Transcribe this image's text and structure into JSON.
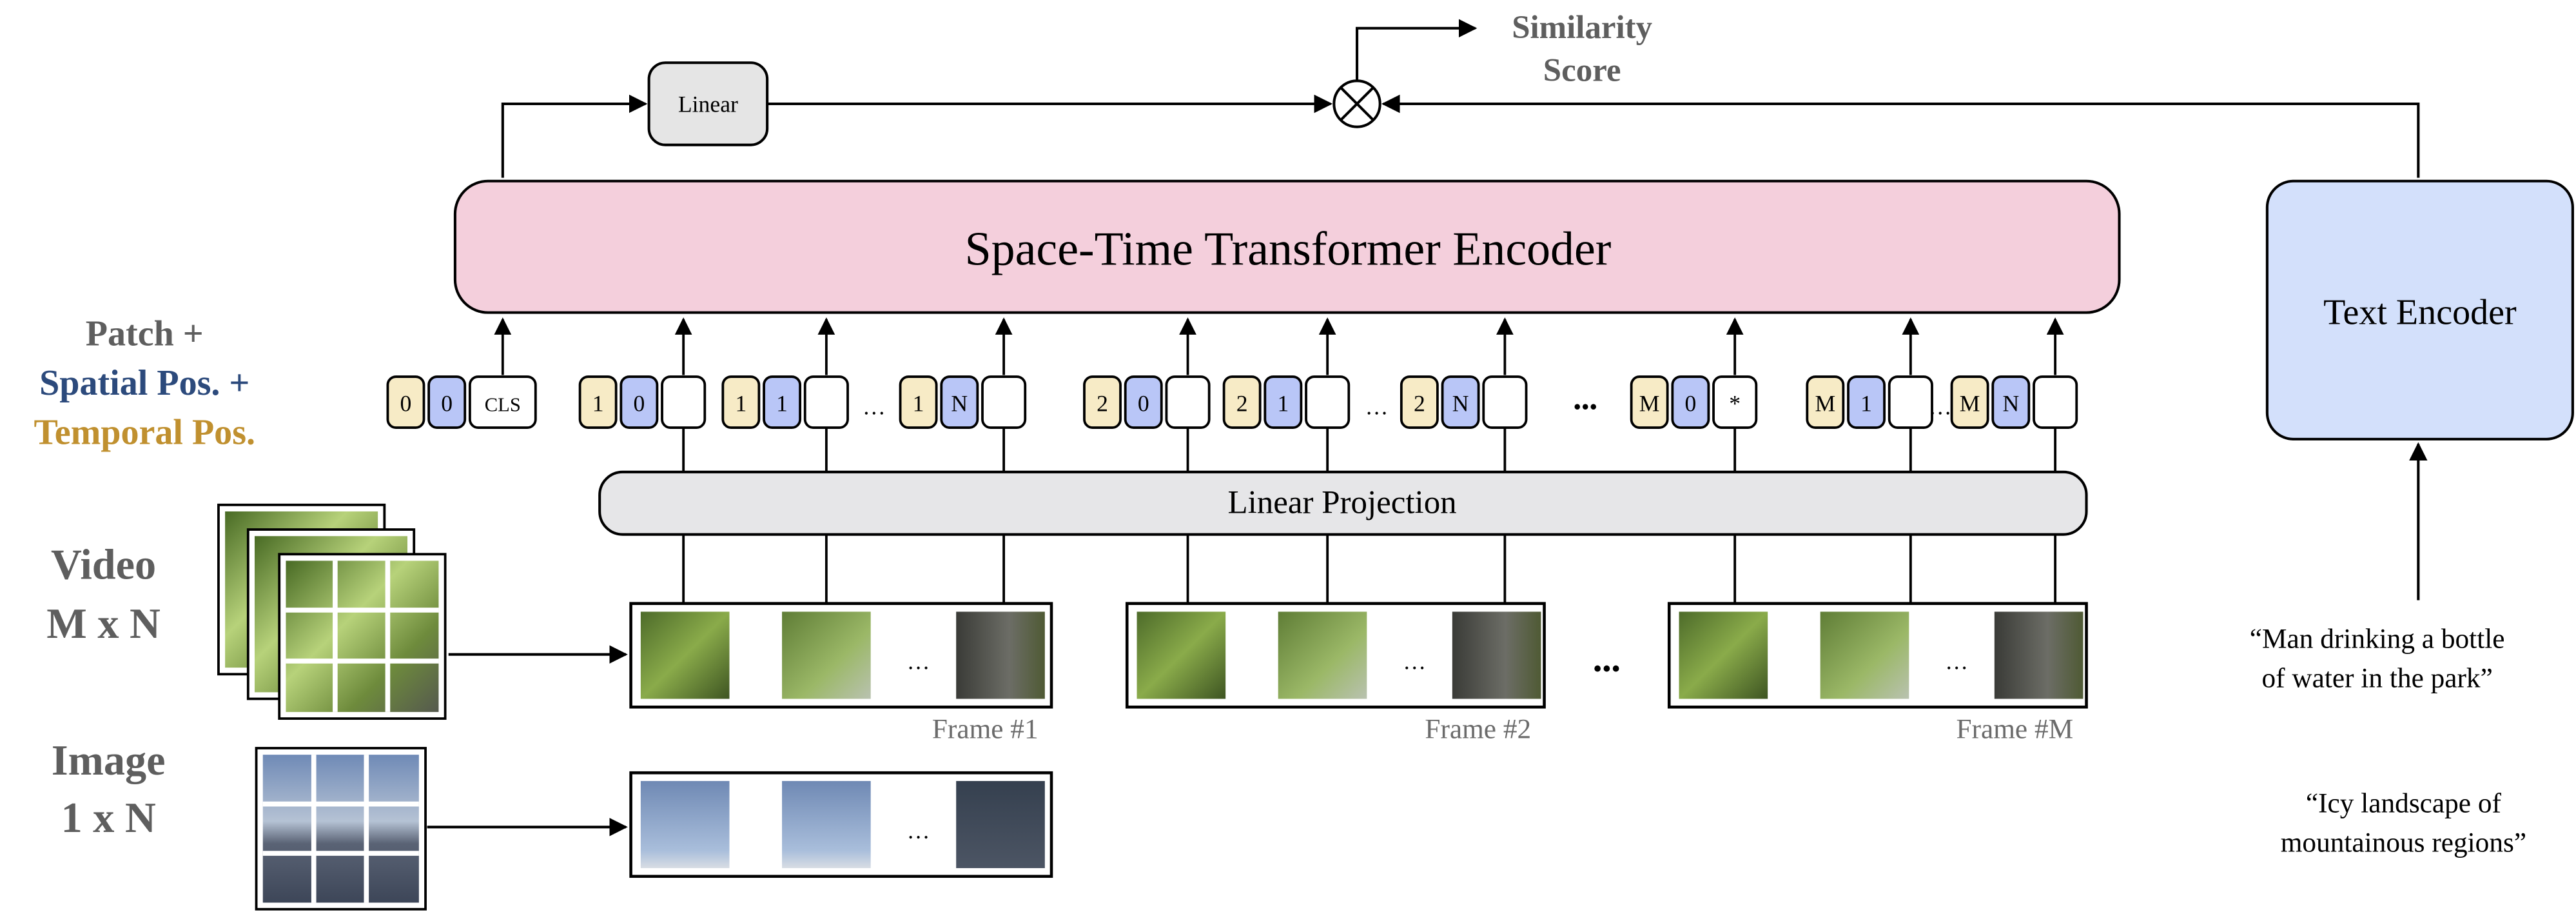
{
  "linear_label": "Linear",
  "similarity": {
    "line1": "Similarity",
    "line2": "Score"
  },
  "encoder_label": "Space-Time Transformer Encoder",
  "text_encoder_label": "Text Encoder",
  "projection_label": "Linear Projection",
  "legend": {
    "patch": "Patch +",
    "spatial": "Spatial Pos. +",
    "temporal": "Temporal Pos.",
    "spatial_color": "#2c4a7c",
    "temporal_color": "#c0902f"
  },
  "inputs": {
    "video_line1": "Video",
    "video_line2": "M x N",
    "image_line1": "Image",
    "image_line2": "1 x N"
  },
  "frames": [
    "Frame #1",
    "Frame #2",
    "Frame #M"
  ],
  "ellipsis": "…",
  "big_ellipsis": "•••",
  "captions": {
    "video_line1": "“Man drinking a bottle",
    "video_line2": "of water in the park”",
    "image_line1": "“Icy landscape of",
    "image_line2": "mountainous regions”"
  },
  "colors": {
    "temporal_token": "#f7ebc6",
    "spatial_token": "#b9c6f7",
    "encoder_fill": "#f4cfdc",
    "text_encoder_fill": "#d3e0fb",
    "projection_fill": "#e6e6e8",
    "label_gray": "#5e5e5e"
  },
  "tokens": [
    {
      "temporal": "0",
      "spatial": "0",
      "patch": "CLS"
    },
    {
      "temporal": "1",
      "spatial": "0",
      "patch": ""
    },
    {
      "temporal": "1",
      "spatial": "1",
      "patch": ""
    },
    {
      "temporal": "1",
      "spatial": "N",
      "patch": ""
    },
    {
      "temporal": "2",
      "spatial": "0",
      "patch": ""
    },
    {
      "temporal": "2",
      "spatial": "1",
      "patch": ""
    },
    {
      "temporal": "2",
      "spatial": "N",
      "patch": ""
    },
    {
      "temporal": "M",
      "spatial": "0",
      "patch": "*"
    },
    {
      "temporal": "M",
      "spatial": "1",
      "patch": ""
    },
    {
      "temporal": "M",
      "spatial": "N",
      "patch": ""
    }
  ]
}
